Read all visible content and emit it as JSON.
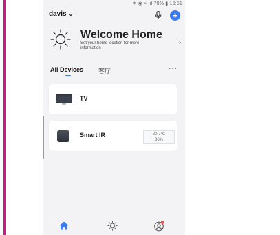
{
  "status_bar": {
    "text": "✶ ◉ ≈ .ıl 70% ▮ 15:51"
  },
  "header": {
    "home_name": "davis",
    "chevron": "⌄"
  },
  "welcome": {
    "title": "Welcome Home",
    "subtitle": "Set your home location for more information",
    "chevron": "›"
  },
  "tabs": [
    {
      "label": "All Devices",
      "active": true
    },
    {
      "label": "客厅",
      "active": false
    }
  ],
  "more_label": "···",
  "devices": [
    {
      "name": "TV",
      "icon": "tv-icon"
    },
    {
      "name": "Smart IR",
      "icon": "smart-ir-icon",
      "temperature": "20.7℃",
      "humidity": "36%"
    }
  ],
  "bottom_nav": [
    {
      "icon": "home-icon",
      "active": true
    },
    {
      "icon": "smart-sun-icon",
      "active": false
    },
    {
      "icon": "profile-icon",
      "active": false,
      "badge": true
    }
  ],
  "colors": {
    "accent": "#3a7bf0",
    "frame_border": "#d4148f",
    "background": "#f3f3f5",
    "badge": "#e64b3c"
  }
}
